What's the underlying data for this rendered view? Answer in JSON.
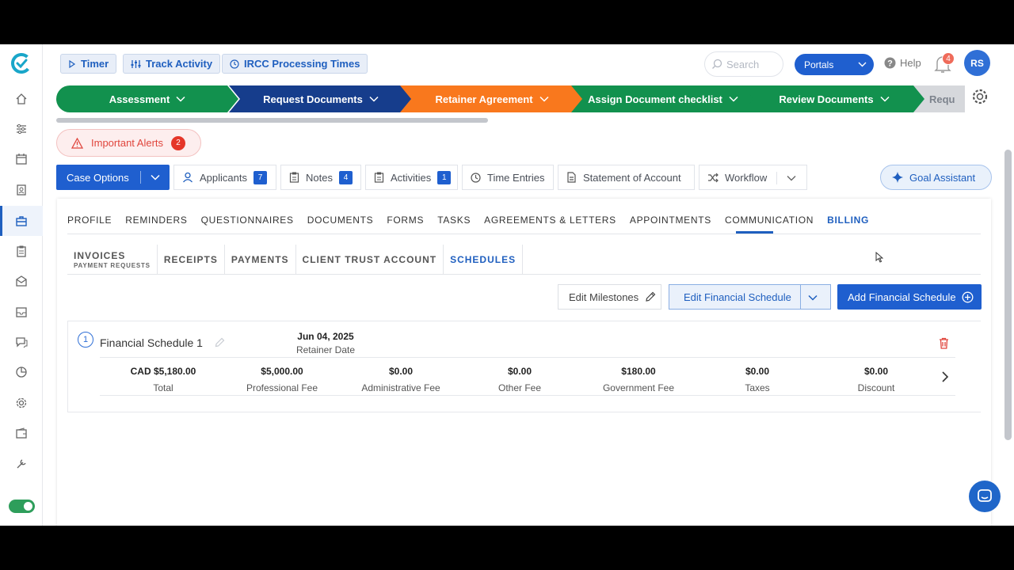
{
  "topbar": {
    "timer": "Timer",
    "track_activity": "Track Activity",
    "processing_times": "IRCC Processing Times",
    "search_placeholder": "Search",
    "portals": "Portals",
    "help": "Help",
    "notifications": "4",
    "avatar": "RS"
  },
  "stages": [
    {
      "label": "Assessment"
    },
    {
      "label": "Request Documents"
    },
    {
      "label": "Retainer Agreement"
    },
    {
      "label": "Assign Document checklist"
    },
    {
      "label": "Review Documents"
    },
    {
      "label": "Requ"
    }
  ],
  "alerts": {
    "label": "Important Alerts",
    "count": "2"
  },
  "case_bar": {
    "case_options": "Case Options",
    "applicants": "Applicants",
    "applicants_count": "7",
    "notes": "Notes",
    "notes_count": "4",
    "activities": "Activities",
    "activities_count": "1",
    "time_entries": "Time Entries",
    "statement": "Statement of Account",
    "workflow": "Workflow",
    "goal_assistant": "Goal Assistant"
  },
  "main_tabs": [
    "PROFILE",
    "REMINDERS",
    "QUESTIONNAIRES",
    "DOCUMENTS",
    "FORMS",
    "TASKS",
    "AGREEMENTS & LETTERS",
    "APPOINTMENTS",
    "COMMUNICATION",
    "BILLING"
  ],
  "active_main_tab": "BILLING",
  "sub_tabs": {
    "invoices": "INVOICES",
    "invoices_sub": "PAYMENT REQUESTS",
    "receipts": "RECEIPTS",
    "payments": "PAYMENTS",
    "trust": "CLIENT TRUST ACCOUNT",
    "schedules": "SCHEDULES"
  },
  "actions": {
    "edit_milestones": "Edit Milestones",
    "edit_schedule": "Edit Financial Schedule",
    "add_schedule": "Add Financial Schedule"
  },
  "schedule": {
    "number": "1",
    "title": "Financial Schedule 1",
    "date_value": "Jun 04, 2025",
    "date_label": "Retainer Date",
    "fees": [
      {
        "value": "CAD $5,180.00",
        "label": "Total"
      },
      {
        "value": "$5,000.00",
        "label": "Professional Fee"
      },
      {
        "value": "$0.00",
        "label": "Administrative Fee"
      },
      {
        "value": "$0.00",
        "label": "Other Fee"
      },
      {
        "value": "$180.00",
        "label": "Government Fee"
      },
      {
        "value": "$0.00",
        "label": "Taxes"
      },
      {
        "value": "$0.00",
        "label": "Discount"
      }
    ]
  },
  "colors": {
    "primary": "#1f5fcf",
    "stage_green": "#12914e",
    "stage_navy": "#163d8c",
    "stage_orange": "#f9781d",
    "alert_red": "#e53629"
  }
}
